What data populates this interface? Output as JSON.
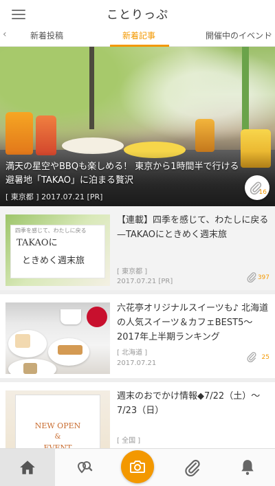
{
  "header": {
    "logo": "ことりっぷ"
  },
  "tabs": [
    {
      "label": "新着投稿"
    },
    {
      "label": "新着記事"
    },
    {
      "label": "開催中のイベント"
    }
  ],
  "hero": {
    "title": "満天の星空やBBQも楽しめる！ 東京から1時間半で行ける避暑地「TAKAO」に泊まる贅沢",
    "meta": "[ 東京都 ] 2017.07.21 [PR]",
    "clip_count": "16"
  },
  "articles": [
    {
      "title": "【連載】四季を感じて、わたしに戻る—TAKAOにときめく週末旅",
      "region": "[ 東京都 ]",
      "date": "2017.07.21 [PR]",
      "clip_count": "397",
      "thumb": {
        "sub": "四季を感じて、わたしに戻る",
        "line1": "TAKAOに",
        "line2": "ときめく週末旅"
      }
    },
    {
      "title": "六花亭オリジナルスイーツも♪ 北海道の人気スイーツ＆カフェBEST5〜2017年上半期ランキング",
      "region": "[ 北海道 ]",
      "date": "2017.07.21",
      "clip_count": "25"
    },
    {
      "title": "週末のおでかけ情報◆7/22（土）〜7/23（日）",
      "region": "[ 全国 ]",
      "date": "",
      "clip_count": "",
      "thumb": {
        "line1": "NEW OPEN",
        "line2": "&",
        "line3": "EVENT"
      }
    }
  ],
  "bottom_nav": [
    {
      "icon": "home-icon"
    },
    {
      "icon": "search-location-icon"
    },
    {
      "icon": "camera-icon"
    },
    {
      "icon": "paperclip-icon"
    },
    {
      "icon": "bell-icon"
    }
  ],
  "colors": {
    "accent": "#f39800",
    "text": "#333333",
    "muted": "#999999"
  }
}
